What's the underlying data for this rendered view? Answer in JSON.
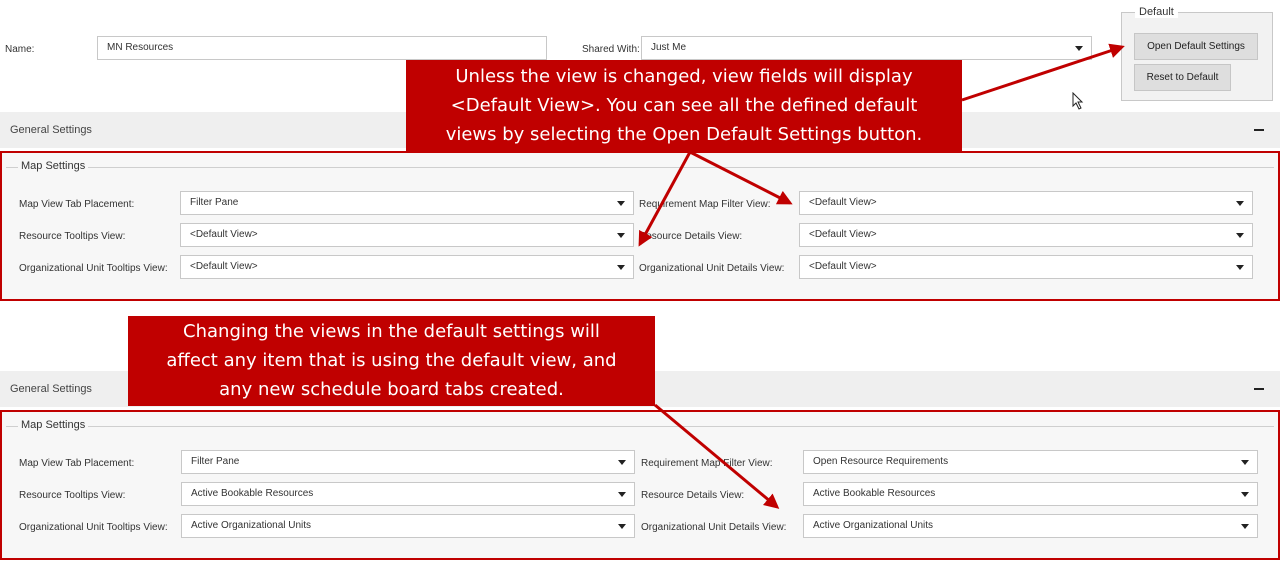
{
  "header": {
    "name_label": "Name:",
    "name_value": "MN Resources",
    "shared_label": "Shared With:",
    "shared_value": "Just Me"
  },
  "default_group": {
    "legend": "Default",
    "open_button": "Open Default Settings",
    "reset_button": "Reset to Default"
  },
  "callout_top": {
    "lines": [
      "Unless the view is changed, view fields will display",
      "<Default View>. You can see all the defined default",
      "views by selecting the Open Default Settings button."
    ]
  },
  "callout_bottom": {
    "lines": [
      "Changing the views in the default settings will",
      "affect any item that is using the default view, and",
      "any new schedule board tabs created."
    ]
  },
  "panel_top": {
    "section_title": "General Settings",
    "group_title": "Map Settings",
    "fields": {
      "map_tab_label": "Map View Tab Placement:",
      "map_tab_value": "Filter Pane",
      "res_tooltips_label": "Resource Tooltips View:",
      "res_tooltips_value": "<Default View>",
      "ou_tooltips_label": "Organizational Unit Tooltips View:",
      "ou_tooltips_value": "<Default View>",
      "req_filter_label": "Requirement Map Filter View:",
      "req_filter_value": "<Default View>",
      "res_details_label": "Resource Details View:",
      "res_details_value": "<Default View>",
      "ou_details_label": "Organizational Unit Details View:",
      "ou_details_value": "<Default View>"
    }
  },
  "panel_bottom": {
    "section_title": "General Settings",
    "group_title": "Map Settings",
    "fields": {
      "map_tab_label": "Map View Tab Placement:",
      "map_tab_value": "Filter Pane",
      "res_tooltips_label": "Resource Tooltips View:",
      "res_tooltips_value": "Active Bookable Resources",
      "ou_tooltips_label": "Organizational Unit Tooltips View:",
      "ou_tooltips_value": "Active Organizational Units",
      "req_filter_label": "Requirement Map Filter View:",
      "req_filter_value": "Open Resource Requirements",
      "res_details_label": "Resource Details View:",
      "res_details_value": "Active Bookable Resources",
      "ou_details_label": "Organizational Unit Details View:",
      "ou_details_value": "Active Organizational Units"
    }
  },
  "colors": {
    "accent_red": "#c00000",
    "section_bar": "#efefef"
  }
}
